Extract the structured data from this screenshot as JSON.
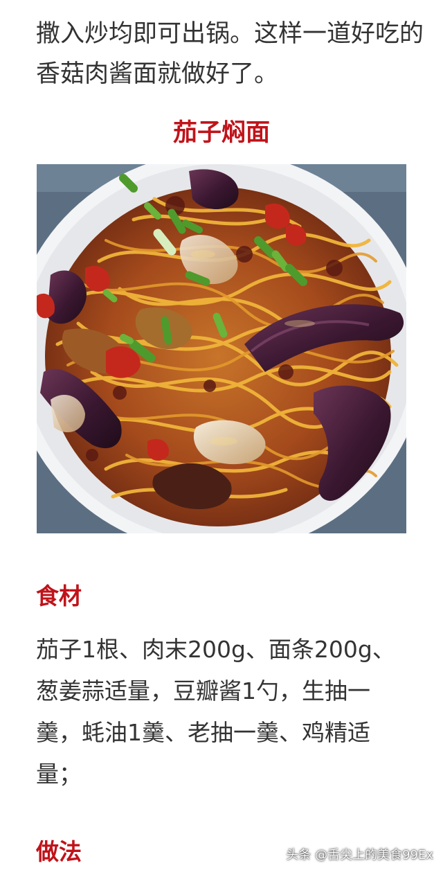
{
  "article": {
    "intro_text": "撒入炒均即可出锅。这样一道好吃的香菇肉酱面就做好了。",
    "recipe_title": "茄子焖面",
    "ingredients_heading": "食材",
    "ingredients_text": "茄子1根、肉末200g、面条200g、葱姜蒜适量，豆瓣酱1勺，生抽一羹，蚝油1羹、老抽一羹、鸡精适量；",
    "method_heading": "做法"
  },
  "watermark": {
    "text": "头条 @舌尖上的美食99Ex"
  },
  "colors": {
    "heading_red": "#c0131a",
    "body_text": "#333333"
  }
}
